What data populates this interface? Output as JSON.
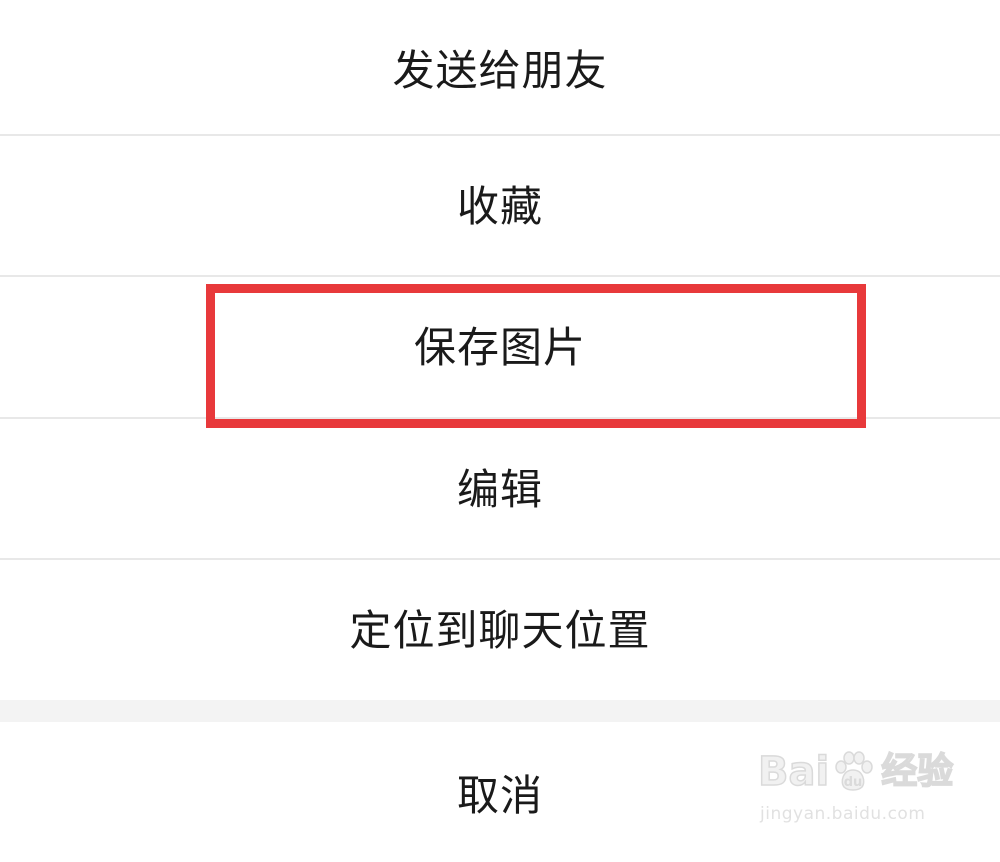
{
  "menu": {
    "items": [
      {
        "label": "发送给朋友"
      },
      {
        "label": "收藏"
      },
      {
        "label": "保存图片"
      },
      {
        "label": "编辑"
      },
      {
        "label": "定位到聊天位置"
      }
    ],
    "cancel_label": "取消"
  },
  "highlight": {
    "target": "保存图片",
    "color": "#e8393b"
  },
  "watermark": {
    "brand_prefix": "Bai",
    "brand_suffix": "经验",
    "url": "jingyan.baidu.com"
  }
}
